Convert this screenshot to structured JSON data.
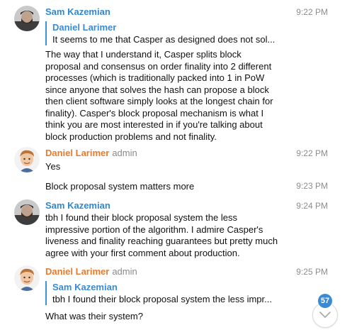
{
  "colors": {
    "sam": "#2f88d0",
    "daniel": "#e77b2d",
    "quote_bar": "#3b94d9",
    "badge": "#3a8ad6"
  },
  "messages": [
    {
      "sender": "Sam Kazemian",
      "time": "9:22 PM",
      "reply_to": {
        "name": "Daniel Larimer",
        "text": "It seems to me that Casper as designed does not sol..."
      },
      "text": "The way that I understand it, Casper splits block proposal and consensus on order finality into 2 different processes (which is traditionally packed into 1 in PoW since anyone that solves the hash can propose a block then client software simply looks at the longest chain for finality). Casper's block proposal mechanism is what I think you are most interested in if you're talking about block production problems and not finality."
    },
    {
      "sender": "Daniel Larimer",
      "role": "admin",
      "time": "9:22 PM",
      "text": "Yes"
    },
    {
      "time": "9:23 PM",
      "text": "Block proposal system matters more"
    },
    {
      "sender": "Sam Kazemian",
      "time": "9:24 PM",
      "text": "tbh I found their block proposal system the less impressive portion of the algorithm. I admire Casper's liveness and finality reaching guarantees but pretty much agree with your first comment about production."
    },
    {
      "sender": "Daniel Larimer",
      "role": "admin",
      "time": "9:25 PM",
      "reply_to": {
        "name": "Sam Kazemian",
        "text": "tbh I found their block proposal system the less impr..."
      },
      "text": "What was their system?"
    }
  ],
  "unread_count": "57",
  "icons": {
    "avatar_sam": "avatar-sam-icon",
    "avatar_daniel": "avatar-daniel-icon",
    "scroll": "chevron-down-icon"
  }
}
